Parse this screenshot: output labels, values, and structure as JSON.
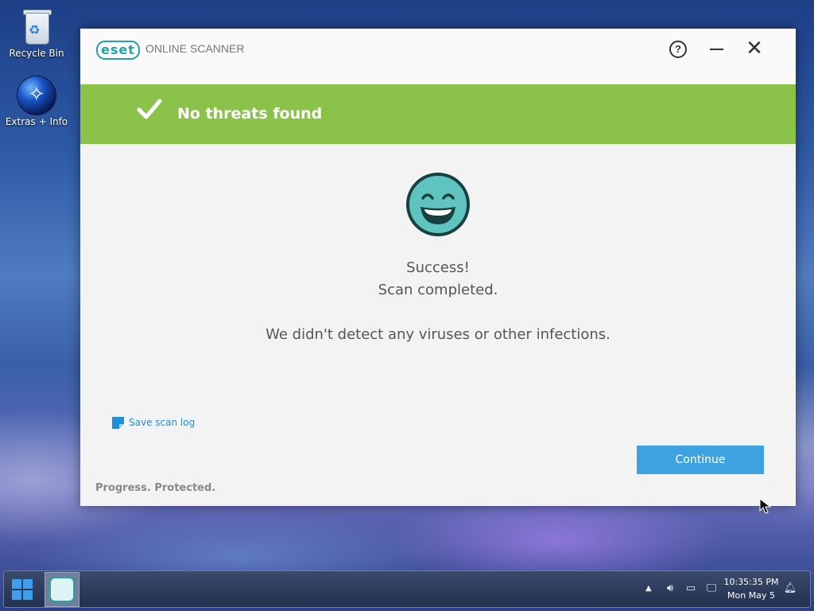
{
  "desktop": {
    "icons": [
      {
        "label": "Recycle Bin"
      },
      {
        "label": "Extras + Info"
      }
    ]
  },
  "window": {
    "logo_text": "eset",
    "product_name": "ONLINE SCANNER",
    "banner_text": "No threats found",
    "result_line1": "Success!",
    "result_line2": "Scan completed.",
    "result_detail": "We didn't detect any viruses or other infections.",
    "save_log_label": "Save scan log",
    "continue_label": "Continue",
    "slogan": "Progress. Protected."
  },
  "taskbar": {
    "time": "10:35:35 PM",
    "date": "Mon May 5"
  },
  "colors": {
    "banner_green": "#8bc34a",
    "brand_teal": "#24a3a3",
    "button_blue": "#3da3e0",
    "link_blue": "#1f8fd6"
  }
}
